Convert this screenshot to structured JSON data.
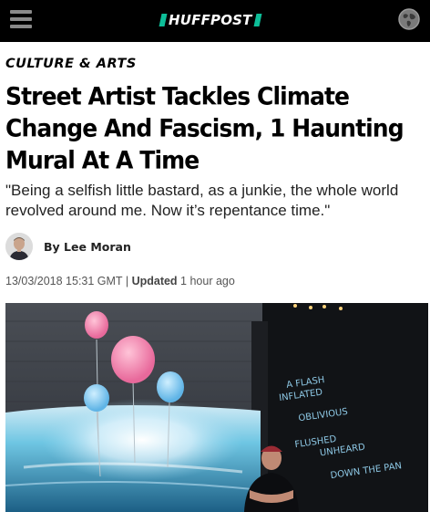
{
  "header": {
    "logo_text": "HUFFPOST",
    "logo_accent_color": "#0dbe98",
    "menu_icon": "hamburger-menu-icon",
    "edition_icon": "globe-icon"
  },
  "article": {
    "section": "CULTURE & ARTS",
    "headline": "Street Artist Tackles Climate Change And Fascism, 1 Haunting Mural At A Time",
    "dek": "\"Being a selfish little bastard, as a junkie, the whole world revolved around me. Now it’s repentance time.\"",
    "byline": {
      "prefix": "By",
      "author": "Lee Moran"
    },
    "dateline": {
      "published": "13/03/2018 15:31 GMT",
      "separator": "|",
      "updated_label": "Updated",
      "updated_value": "1 hour ago"
    },
    "hero_image": {
      "mural_text_lines": [
        "A FLASH",
        "INFLATED",
        "OBLIVIOUS",
        "FLUSHED",
        "UNHEARD",
        "DOWN THE PAN"
      ]
    }
  }
}
